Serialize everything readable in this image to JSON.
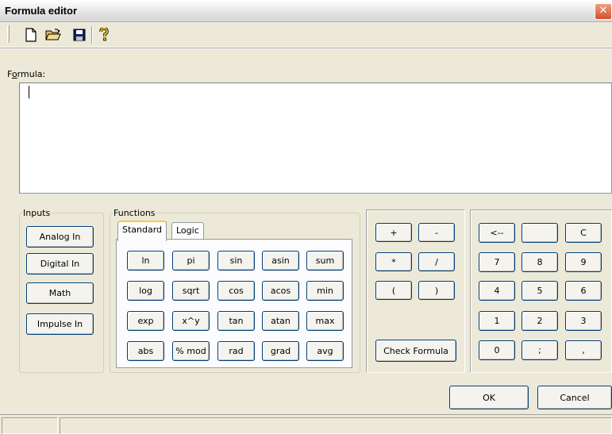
{
  "window": {
    "title": "Formula editor",
    "close_symbol": "✕"
  },
  "toolbar": {
    "new_icon": "new-file-icon",
    "open_icon": "open-folder-icon",
    "save_icon": "save-disk-icon",
    "help_icon": "help-question-icon"
  },
  "formula": {
    "label_prefix": "F",
    "label_accel": "o",
    "label_rest": "rmula:",
    "value": ""
  },
  "inputs": {
    "legend": "Inputs",
    "buttons": [
      "Analog In",
      "Digital In",
      "Math",
      "Impulse In"
    ]
  },
  "functions": {
    "legend": "Functions",
    "tabs": [
      "Standard",
      "Logic"
    ],
    "active_tab": "Standard",
    "rows": [
      [
        "ln",
        "pi",
        "sin",
        "asin",
        "sum"
      ],
      [
        "log",
        "sqrt",
        "cos",
        "acos",
        "min"
      ],
      [
        "exp",
        "x^y",
        "tan",
        "atan",
        "max"
      ],
      [
        "abs",
        "% mod",
        "rad",
        "grad",
        "avg"
      ]
    ]
  },
  "operators": {
    "rows": [
      [
        "+",
        "-"
      ],
      [
        "*",
        "/"
      ],
      [
        "(",
        ")"
      ]
    ],
    "check_formula": "Check Formula"
  },
  "keypad": {
    "rows": [
      [
        "<--",
        "",
        "C"
      ],
      [
        "7",
        "8",
        "9"
      ],
      [
        "4",
        "5",
        "6"
      ],
      [
        "1",
        "2",
        "3"
      ],
      [
        "0",
        ";",
        ","
      ]
    ]
  },
  "dialog": {
    "ok": "OK",
    "cancel": "Cancel"
  },
  "status": {
    "pane1": "",
    "pane2": ""
  }
}
